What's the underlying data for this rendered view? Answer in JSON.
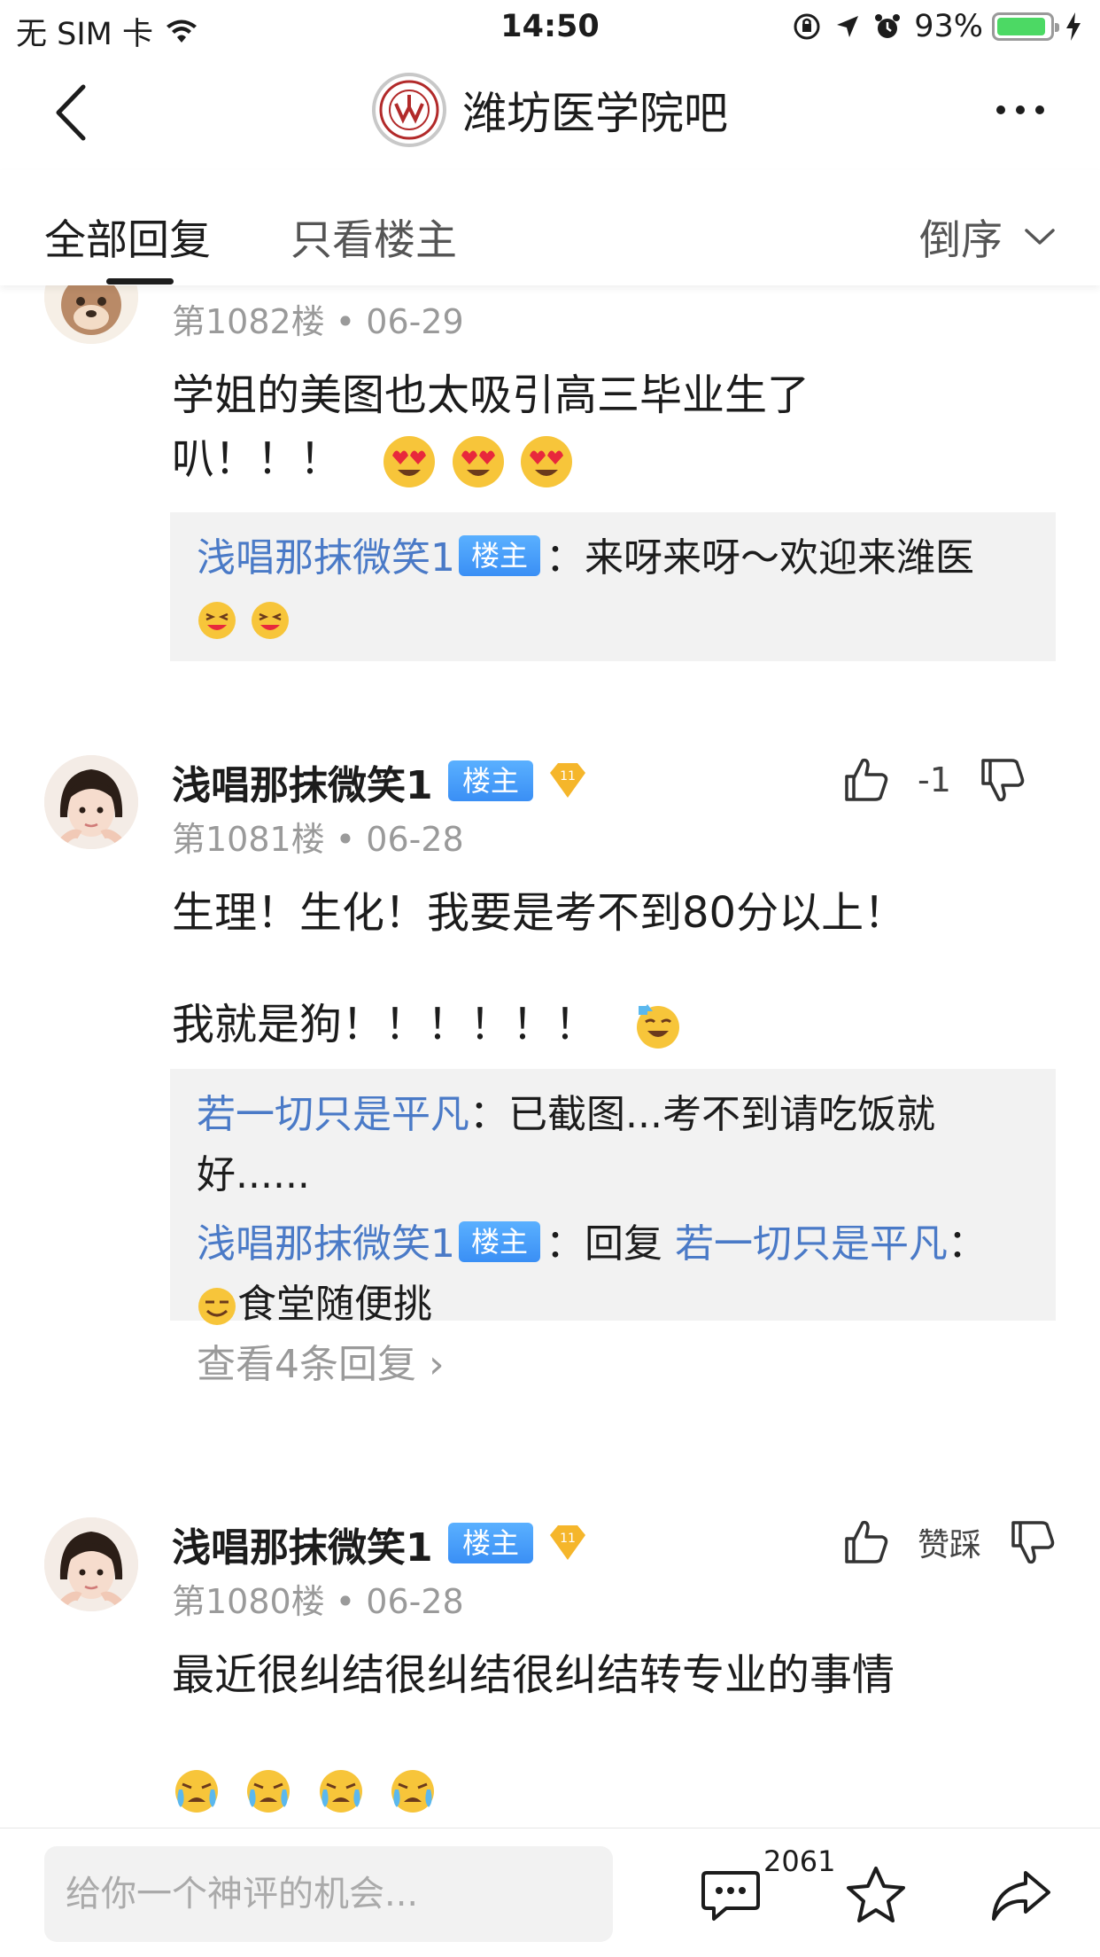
{
  "status_bar": {
    "carrier": "无 SIM 卡",
    "time": "14:50",
    "battery_percent": "93%",
    "battery_level": 0.93,
    "battery_color": "#4cd964"
  },
  "nav": {
    "title": "潍坊医学院吧",
    "back_icon": "chevron-left-icon",
    "more_icon": "more-dots-icon"
  },
  "tabs": {
    "all_replies": "全部回复",
    "only_host": "只看楼主",
    "sort_label": "倒序"
  },
  "posts": [
    {
      "floor_date": "第1082楼 • 06-29",
      "body_lines": [
        "学姐的美图也太吸引高三毕业生了",
        "叭！！！"
      ],
      "replies": [
        {
          "user": "浅唱那抹微笑1",
          "badge": "楼主",
          "text": "：来呀来呀～欢迎来潍医"
        }
      ]
    },
    {
      "username": "浅唱那抹微笑1",
      "badge": "楼主",
      "level": "11",
      "floor_date": "第1081楼 • 06-28",
      "vote_count": "-1",
      "body_lines": [
        "生理！生化！我要是考不到80分以上！",
        "我就是狗！！！！！！"
      ],
      "replies": [
        {
          "user": "若一切只是平凡",
          "text": "：已截图...考不到请吃饭就好......"
        },
        {
          "user": "浅唱那抹微笑1",
          "badge": "楼主",
          "text": "：回复",
          "target": "若一切只是平凡",
          "text2": "：",
          "text3": "食堂随便挑"
        }
      ],
      "more_replies": "查看4条回复 ›"
    },
    {
      "username": "浅唱那抹微笑1",
      "badge": "楼主",
      "level": "11",
      "floor_date": "第1080楼 • 06-28",
      "vote_label": "赞踩",
      "body_lines": [
        "最近很纠结很纠结很纠结转专业的事情"
      ]
    }
  ],
  "bottom_bar": {
    "placeholder": "给你一个神评的机会...",
    "comment_count": "2061"
  }
}
